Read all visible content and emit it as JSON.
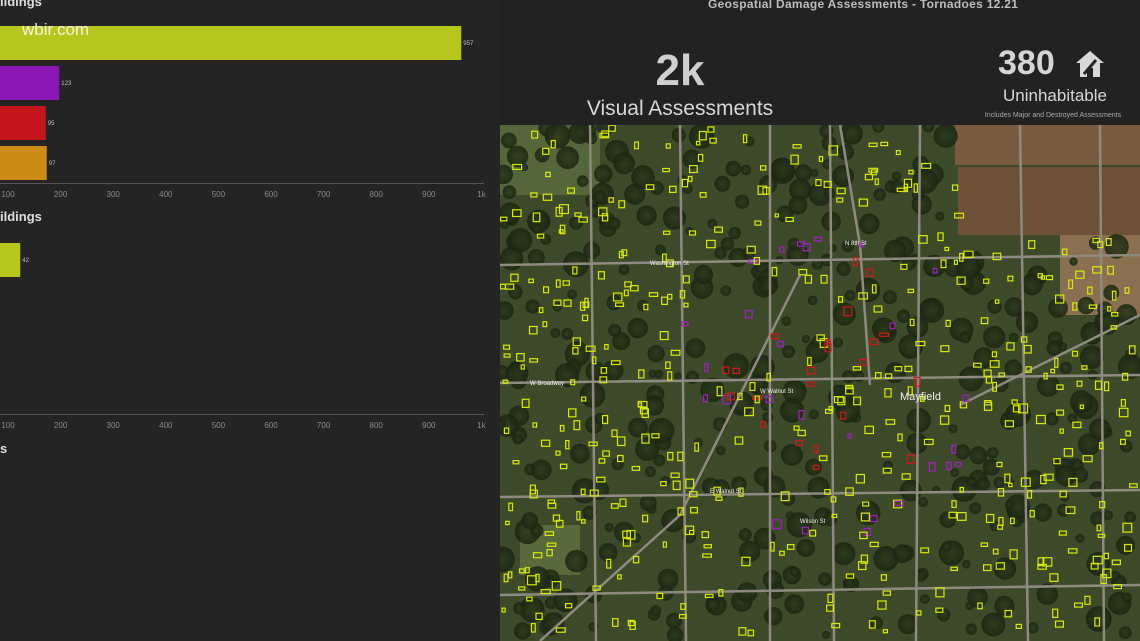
{
  "header": {
    "watermark": "wbir.com",
    "dashboard_title": "Geospatial Damage Assessments - Tornadoes 12.21"
  },
  "charts": {
    "section1_title": "ildings",
    "section2_title": "ildings",
    "section3_title": "s",
    "ticks": [
      "100",
      "200",
      "300",
      "400",
      "500",
      "600",
      "700",
      "800",
      "900",
      "1k"
    ]
  },
  "chart_data": [
    {
      "type": "bar",
      "orientation": "horizontal",
      "title": "ildings",
      "values": [
        957,
        123,
        95,
        97
      ],
      "value_labels": [
        "957",
        "123",
        "95",
        "97"
      ],
      "colors": [
        "#b7c61d",
        "#8a17b3",
        "#c4141c",
        "#cc8a17"
      ],
      "xlim": [
        0,
        1000
      ]
    },
    {
      "type": "bar",
      "orientation": "horizontal",
      "title": "ildings",
      "values": [
        42
      ],
      "value_labels": [
        "42"
      ],
      "colors": [
        "#b7c61d"
      ],
      "xlim": [
        0,
        1000
      ]
    }
  ],
  "kpi": {
    "assessments_value": "2k",
    "assessments_label": "Visual Assessments",
    "uninhabitable_value": "380",
    "uninhabitable_label": "Uninhabitable",
    "uninhabitable_note": "Includes Major and Destroyed Assessments"
  },
  "map": {
    "place_label": "Mayfield",
    "streets": [
      "W Walnut St",
      "W Broadway",
      "N 8th St",
      "Washington St",
      "E Walnut St",
      "Wilson St"
    ],
    "colors": {
      "minor": "#d7e80c",
      "affected": "#d7e80c",
      "major": "#a020c0",
      "destroyed": "#d01818"
    }
  }
}
